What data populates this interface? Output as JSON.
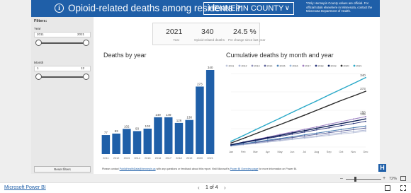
{
  "header": {
    "title": "Opioid-related deaths among residents in",
    "county_selected": "HENNEPIN COUNTY",
    "note": "*Only Hennepin County values are official. For official totals elsewhere in Minnesota, contact the Minnesota Department of Health."
  },
  "filters": {
    "label": "Filters:",
    "year_label": "Year",
    "year_min": "2011",
    "year_max": "2021",
    "month_label": "Month",
    "month_min": "1",
    "month_max": "12",
    "reset_label": "Reset filters"
  },
  "kpis": [
    {
      "value": "2021",
      "label": "Year"
    },
    {
      "value": "340",
      "label": "Opioid-related deaths"
    },
    {
      "value": "24.5 %",
      "label": "Pct change since last year"
    }
  ],
  "charts": {
    "deaths_title": "Deaths by year",
    "cumulative_title": "Cumulative deaths by month and year"
  },
  "chart_data": [
    {
      "type": "bar",
      "title": "Deaths by year",
      "categories": [
        "2011",
        "2012",
        "2013",
        "2014",
        "2015",
        "2016",
        "2017",
        "2018",
        "2019",
        "2020",
        "2021"
      ],
      "values": [
        77,
        83,
        102,
        93,
        103,
        149,
        149,
        126,
        138,
        273,
        340
      ],
      "color": "#1f5fa8",
      "ylim": [
        0,
        360
      ]
    },
    {
      "type": "line",
      "title": "Cumulative deaths by month and year",
      "x": [
        "Jan",
        "Feb",
        "Mar",
        "Apr",
        "May",
        "Jun",
        "Jul",
        "Aug",
        "Sep",
        "Oct",
        "Nov",
        "Dec"
      ],
      "legend_position": "top",
      "ylim": [
        0,
        360
      ],
      "series": [
        {
          "name": "2011",
          "color": "#bfc6dc",
          "values": [
            5,
            11,
            17,
            24,
            30,
            37,
            43,
            50,
            57,
            64,
            70,
            77
          ]
        },
        {
          "name": "2012",
          "color": "#a9b2d2",
          "values": [
            6,
            12,
            19,
            26,
            33,
            40,
            47,
            54,
            62,
            69,
            76,
            83
          ]
        },
        {
          "name": "2013",
          "color": "#8e8fb8",
          "values": [
            8,
            16,
            24,
            33,
            41,
            50,
            59,
            68,
            77,
            86,
            94,
            102
          ]
        },
        {
          "name": "2014",
          "color": "#5a5f98",
          "values": [
            7,
            15,
            22,
            30,
            38,
            46,
            54,
            62,
            70,
            78,
            85,
            93
          ]
        },
        {
          "name": "2015",
          "color": "#4d82b5",
          "values": [
            8,
            16,
            25,
            34,
            42,
            51,
            60,
            68,
            77,
            86,
            95,
            103
          ]
        },
        {
          "name": "2016",
          "color": "#99b7d8",
          "values": [
            12,
            24,
            36,
            48,
            61,
            74,
            86,
            99,
            112,
            124,
            137,
            149
          ]
        },
        {
          "name": "2017",
          "color": "#a07bc0",
          "values": [
            12,
            24,
            37,
            49,
            62,
            74,
            87,
            99,
            112,
            124,
            137,
            149
          ]
        },
        {
          "name": "2018",
          "color": "#28347a",
          "values": [
            10,
            21,
            31,
            42,
            52,
            63,
            73,
            84,
            94,
            105,
            115,
            126
          ]
        },
        {
          "name": "2019",
          "color": "#0e1f56",
          "values": [
            11,
            23,
            34,
            46,
            57,
            69,
            80,
            92,
            103,
            115,
            126,
            138
          ]
        },
        {
          "name": "2020",
          "color": "#2d2d2d",
          "values": [
            20,
            42,
            65,
            88,
            110,
            133,
            156,
            180,
            204,
            228,
            250,
            273
          ]
        },
        {
          "name": "2021",
          "color": "#2aa9c8",
          "values": [
            28,
            56,
            85,
            113,
            141,
            170,
            198,
            226,
            255,
            283,
            311,
            340
          ]
        }
      ],
      "end_labels": [
        "340",
        "273",
        "158",
        "149"
      ]
    }
  ],
  "footer": {
    "text_prefix": "Please contact ",
    "email": "PublicHealthData@hennepin.us",
    "text_mid": " with any questions or feedback about this report. Visit Microsoft's ",
    "link": "Power BI Overview page",
    "text_suffix": " for more information on Power BI."
  },
  "zoom": {
    "percent": "72%"
  },
  "bottom": {
    "powerbi_link": "Microsoft Power BI",
    "page_indicator": "1 of 4"
  }
}
